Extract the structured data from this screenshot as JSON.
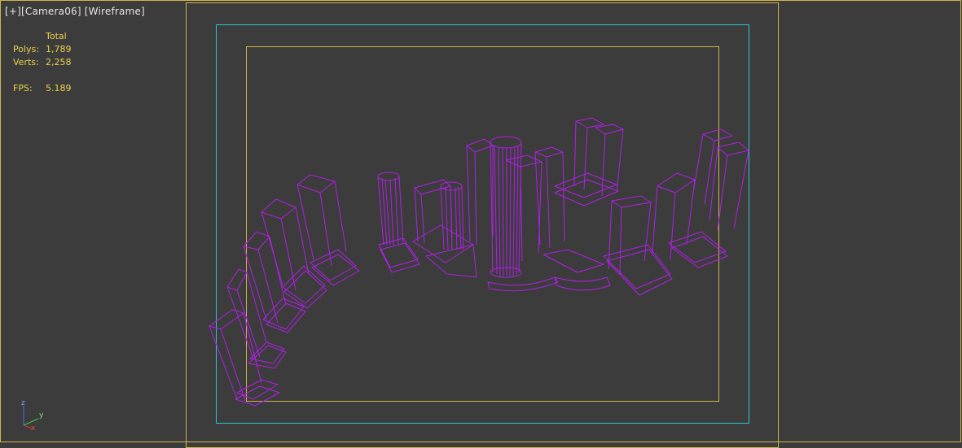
{
  "viewport": {
    "label_plus": "[+]",
    "label_camera": "[Camera06]",
    "label_mode": "[Wireframe]"
  },
  "stats": {
    "header": "Total",
    "polys_label": "Polys:",
    "polys_value": "1,789",
    "verts_label": "Verts:",
    "verts_value": "2,258",
    "fps_label": "FPS:",
    "fps_value": "5.189"
  },
  "axis": {
    "z": "z",
    "y": "y",
    "x": "x"
  },
  "colors": {
    "background": "#3c3c3c",
    "wireframe": "#b21fe8",
    "safe_frame_yellow": "#d2b44a",
    "safe_frame_cyan": "#2ec6d8",
    "stats_text": "#e9d24a"
  }
}
